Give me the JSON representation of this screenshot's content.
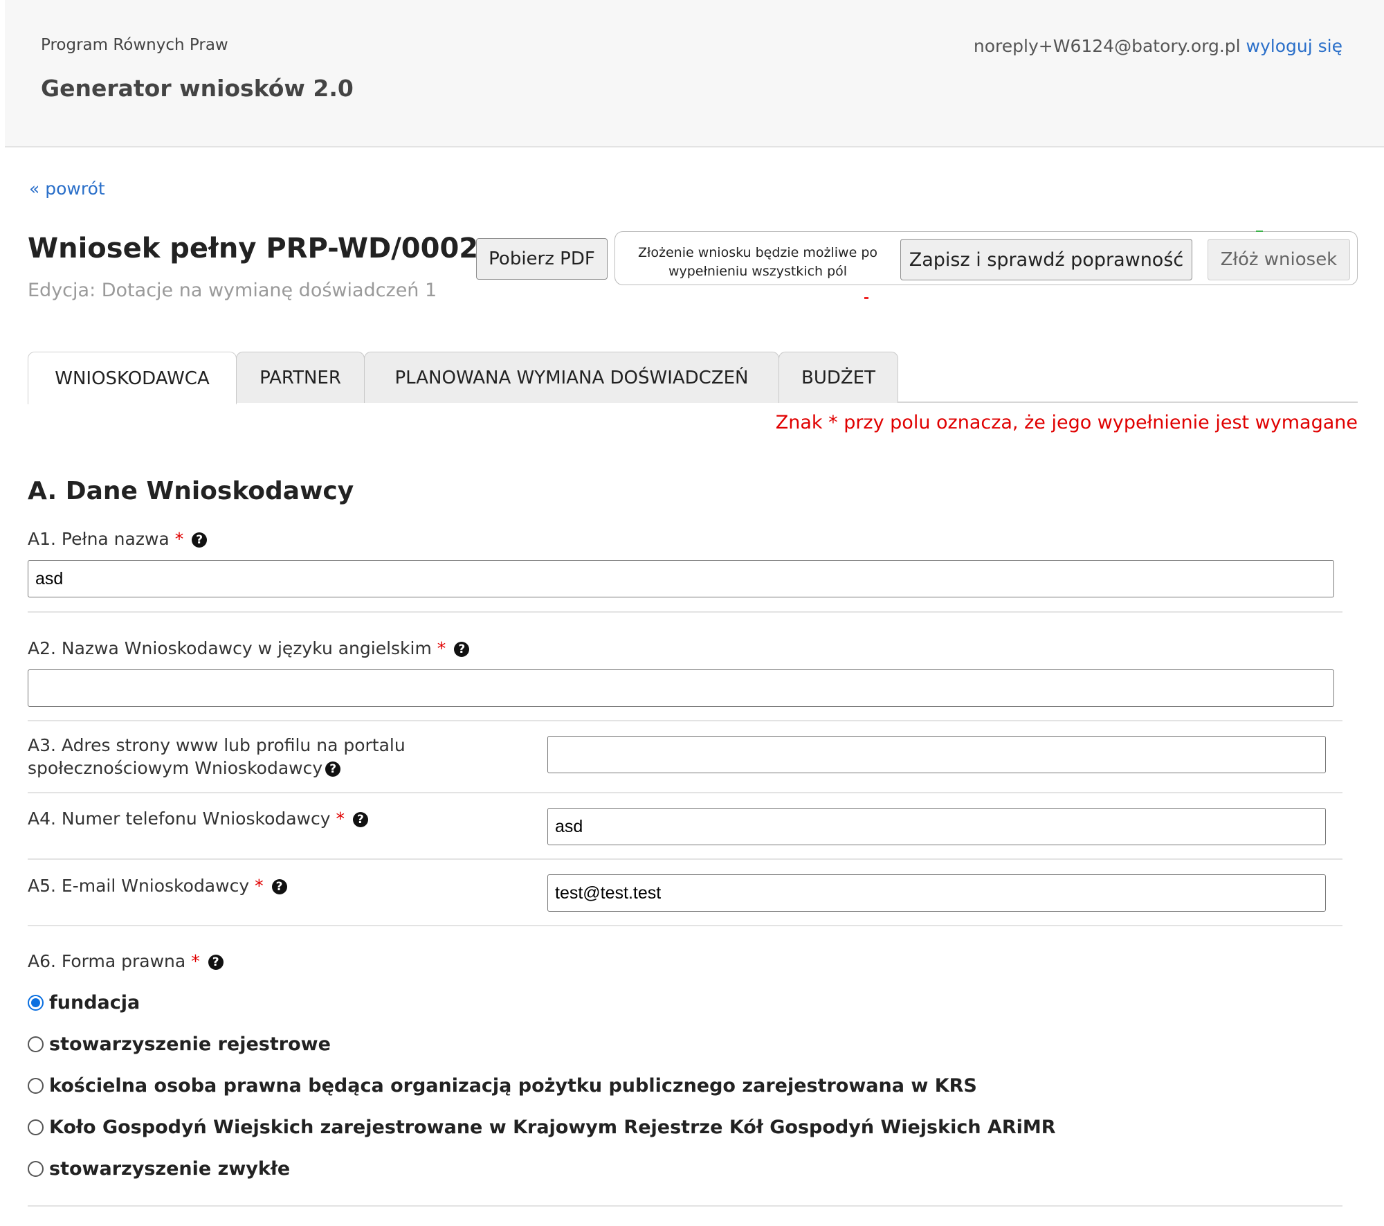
{
  "header": {
    "program": "Program Równych Praw",
    "generator": "Generator wniosków 2.0",
    "email": "noreply+W6124@batory.org.pl",
    "logout": "wyloguj się"
  },
  "nav": {
    "back": "« powrót"
  },
  "application": {
    "title": "Wniosek pełny PRP-WD/0002",
    "edition": "Edycja: Dotacje na wymianę doświadczeń 1",
    "pdf_button": "Pobierz PDF",
    "actions_note": "Złożenie wniosku będzie możliwe po wypełnieniu wszystkich pól",
    "check_button": "Zapisz i sprawdź poprawność",
    "submit_button": "Złóż wniosek"
  },
  "tabs": [
    {
      "label": "WNIOSKODAWCA",
      "active": true
    },
    {
      "label": "PARTNER",
      "active": false
    },
    {
      "label": "PLANOWANA WYMIANA DOŚWIADCZEŃ",
      "active": false
    },
    {
      "label": "BUDŻET",
      "active": false
    }
  ],
  "required_note": "Znak * przy polu oznacza, że jego wypełnienie jest wymagane",
  "section": {
    "title": "A. Dane Wnioskodawcy",
    "fields": [
      {
        "label": "A1. Pełna nazwa",
        "required": "*",
        "value": "asd"
      },
      {
        "label": "A2. Nazwa Wnioskodawcy w języku angielskim",
        "required": "*",
        "value": ""
      },
      {
        "label_line1": "A3. Adres strony www lub profilu na portalu",
        "label_line2": "społecznościowym Wnioskodawcy",
        "value": ""
      },
      {
        "label": "A4. Numer telefonu Wnioskodawcy",
        "required": "*",
        "value": "asd"
      },
      {
        "label": "A5. E-mail Wnioskodawcy",
        "required": "*",
        "value": "test@test.test"
      },
      {
        "label": "A6. Forma prawna",
        "required": "*"
      }
    ],
    "legal_forms": [
      {
        "label": "fundacja",
        "selected": true
      },
      {
        "label": "stowarzyszenie rejestrowe",
        "selected": false
      },
      {
        "label": "kościelna osoba prawna będąca organizacją pożytku publicznego zarejestrowana w KRS",
        "selected": false
      },
      {
        "label": "Koło Gospodyń Wiejskich zarejestrowane w Krajowym Rejestrze Kół Gospodyń Wiejskich ARiMR",
        "selected": false
      },
      {
        "label": "stowarzyszenie zwykłe",
        "selected": false
      }
    ]
  },
  "help_icon_glyph": "?"
}
